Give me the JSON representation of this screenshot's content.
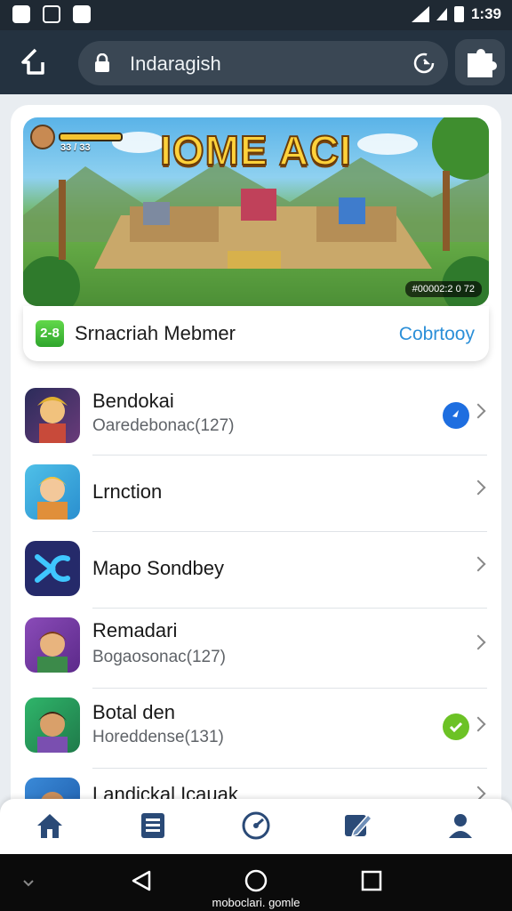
{
  "status_bar": {
    "time": "1:39"
  },
  "browser": {
    "url": "Indaragish",
    "colors": {
      "toolbar": "#243240",
      "pill": "#3a4754"
    }
  },
  "banner": {
    "game_title": "IOME ACI",
    "hud_left": "33 / 33",
    "hud_right": "#00002:2 0 72",
    "badge": "2-8",
    "name": "Srnacriah Mebmer",
    "link": "Cobrtooy"
  },
  "apps": [
    {
      "title": "Bendokai",
      "subtitle": "Oaredebonac(127)",
      "status": "blue-dot",
      "icon": "hero-avatar"
    },
    {
      "title": "Lrnction",
      "subtitle": "",
      "status": "none",
      "icon": "blonde-avatar"
    },
    {
      "title": "Mapo Sondbey",
      "subtitle": "",
      "status": "none",
      "icon": "logo-x"
    },
    {
      "title": "Remadari",
      "subtitle": "Bogaosonac(127)",
      "status": "none",
      "icon": "purple-avatar"
    },
    {
      "title": "Botal den",
      "subtitle": "Horeddense(131)",
      "status": "green-check",
      "icon": "green-avatar"
    },
    {
      "title": "Landickal Icauak",
      "subtitle": "",
      "status": "none",
      "icon": "brown-avatar"
    }
  ],
  "bottom_nav": [
    "home-icon",
    "list-icon",
    "speed-icon",
    "edit-icon",
    "profile-icon"
  ],
  "watermark": "moboclari. gomle",
  "colors": {
    "accent": "#2b8fd8",
    "nav_active": "#2a4a77",
    "check": "#6cc225",
    "dot": "#1e6ee0"
  }
}
